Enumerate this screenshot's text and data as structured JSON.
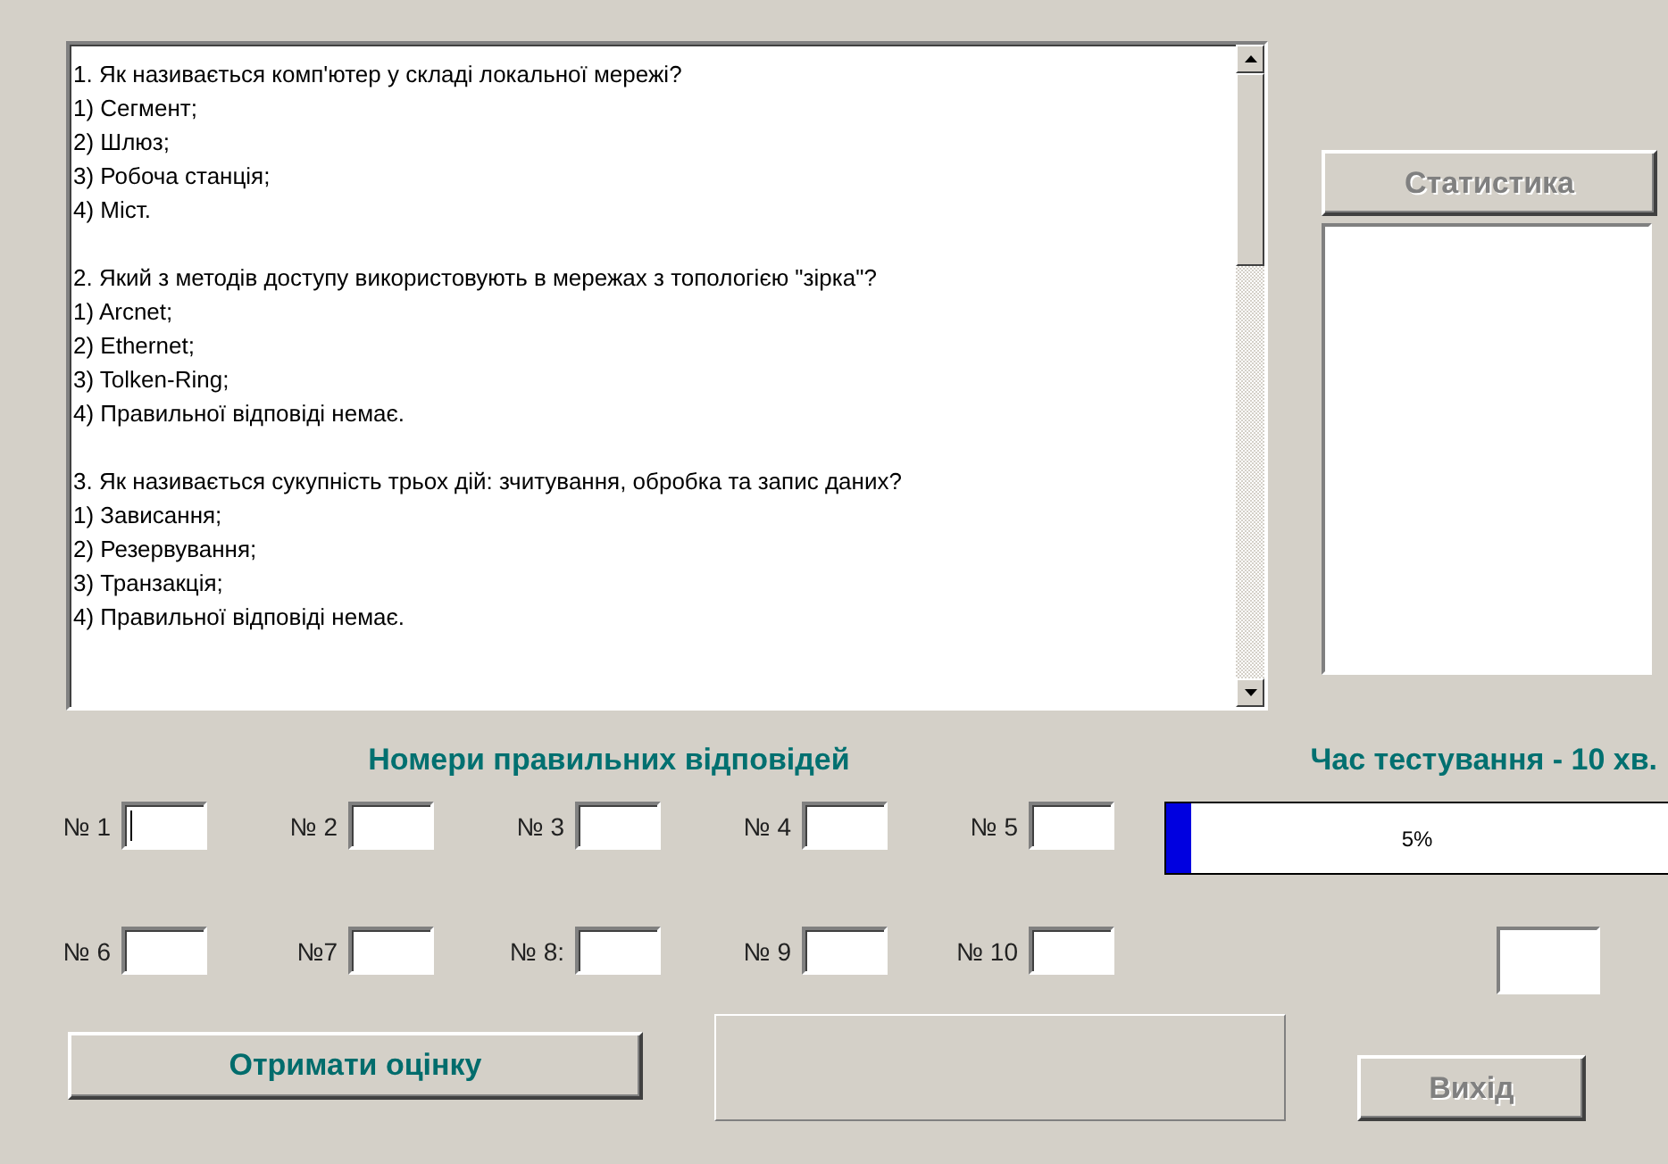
{
  "questions": [
    {
      "question": "1. Як називається комп'ютер у складі локальної мережі?",
      "options": [
        "1) Сегмент;",
        "2) Шлюз;",
        "3) Робоча станція;",
        "4) Міст."
      ]
    },
    {
      "question": "2. Який з методів доступу використовують в мережах з топологією \"зірка\"?",
      "options": [
        "1) Arcnet;",
        "2) Ethernet;",
        "3) Tolken-Ring;",
        "4) Правильної відповіді немає."
      ]
    },
    {
      "question": "3. Як називається сукупність трьох дій: зчитування, обробка та запис даних?",
      "options": [
        "1) Зависання;",
        "2) Резервування;",
        "3) Транзакція;",
        "4) Правильної відповіді немає."
      ]
    }
  ],
  "statistics_button": {
    "label": "Статистика",
    "disabled": true
  },
  "answers_heading": "Номери правильних відповідей",
  "answer_fields": [
    {
      "label": "№ 1",
      "focused": true
    },
    {
      "label": "№ 2",
      "focused": false
    },
    {
      "label": "№ 3",
      "focused": false
    },
    {
      "label": "№ 4",
      "focused": false
    },
    {
      "label": "№ 5",
      "focused": false
    },
    {
      "label": "№ 6",
      "focused": false
    },
    {
      "label": "№7",
      "focused": false
    },
    {
      "label": "№ 8:",
      "focused": false
    },
    {
      "label": "№ 9",
      "focused": false
    },
    {
      "label": "№ 10",
      "focused": false
    }
  ],
  "timer": {
    "heading": "Час тестування - 10 хв.",
    "level": 0.05,
    "reading": "5%"
  },
  "grade_button": {
    "label": "Отримати оцінку",
    "disabled": false
  },
  "exit_button": {
    "label": "Вихід",
    "disabled": true
  }
}
